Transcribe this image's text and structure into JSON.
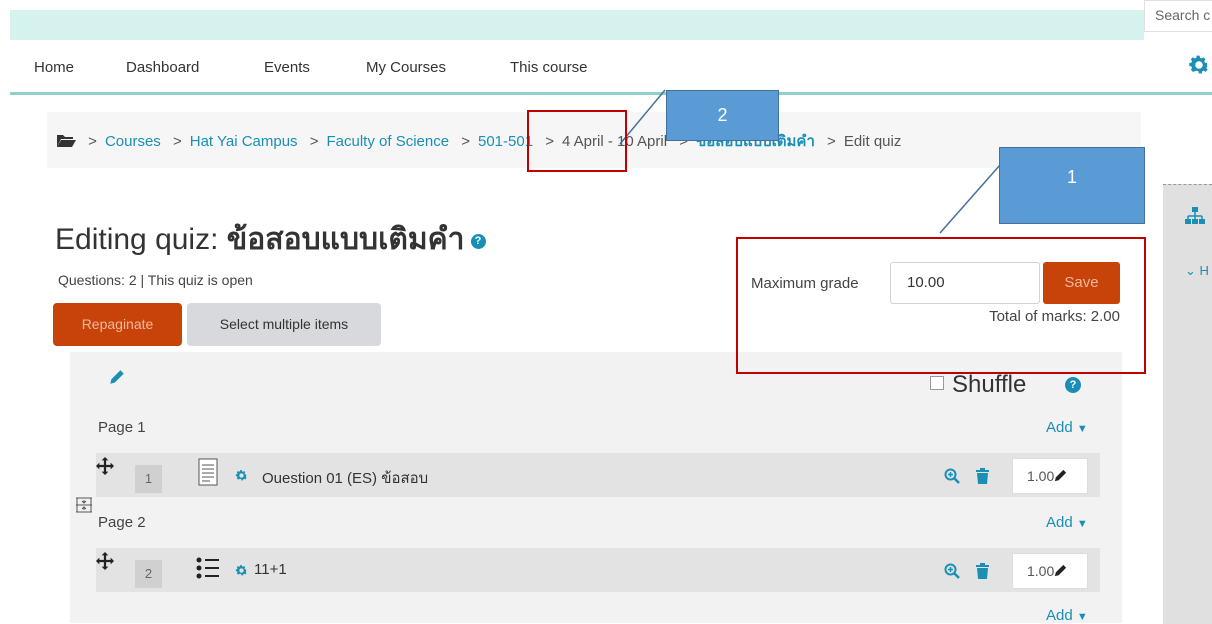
{
  "search": {
    "placeholder": "Search c"
  },
  "nav": {
    "items": [
      "Home",
      "Dashboard",
      "Events",
      "My Courses",
      "This course"
    ]
  },
  "breadcrumb": {
    "items": [
      "Courses",
      "Hat Yai Campus",
      "Faculty of Science",
      "501-501",
      "4 April - 10 April",
      "ข้อสอบแบบเติมคำ",
      "Edit quiz"
    ],
    "separator": ">"
  },
  "page": {
    "title_prefix": "Editing quiz: ",
    "title_name": "ข้อสอบแบบเติมคำ",
    "status": "Questions: 2 | This quiz is open",
    "repaginate": "Repaginate",
    "select_multiple": "Select multiple items"
  },
  "grade": {
    "label": "Maximum grade",
    "value": "10.00",
    "save": "Save",
    "total": "Total of marks: 2.00"
  },
  "quiz": {
    "shuffle": "Shuffle",
    "add": "Add",
    "pages": [
      {
        "label": "Page 1",
        "question": {
          "slot": "1",
          "name": "Ouestion 01 (ES) ข้อสอบ",
          "mark": "1.00"
        }
      },
      {
        "label": "Page 2",
        "question": {
          "slot": "2",
          "name": "11+1",
          "mark": "1.00"
        }
      }
    ]
  },
  "side_panel": {
    "label": "H"
  },
  "annotations": {
    "callout_1": "1",
    "callout_2": "2"
  },
  "colors": {
    "accent": "#1a8fb6",
    "primary_button": "#c8430a",
    "callout": "#5b9bd5",
    "highlight": "#c00000",
    "nav_band": "#d6f2ef"
  }
}
